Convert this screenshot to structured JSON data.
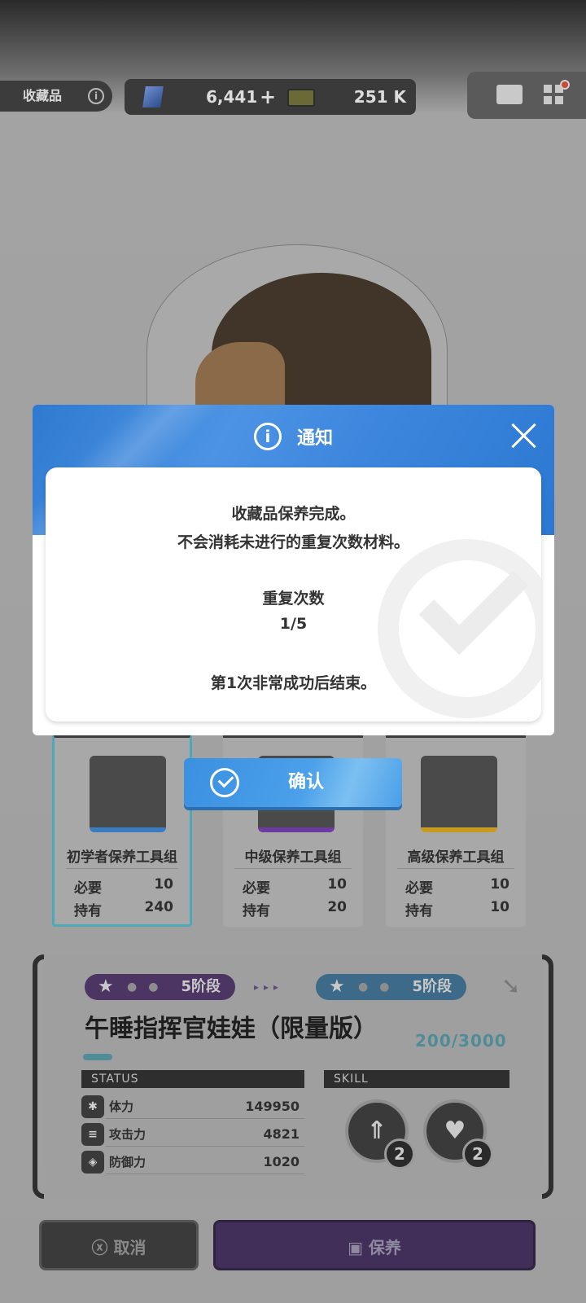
{
  "topbar": {
    "title": "收藏品",
    "info": "i",
    "resource1_value": "6,441",
    "resource1_plus": "+",
    "resource2_value": "251 K"
  },
  "cards": [
    {
      "name": "初学者保养工具组",
      "required_label": "必要",
      "required": "10",
      "owned_label": "持有",
      "owned": "240"
    },
    {
      "name": "中级保养工具组",
      "required_label": "必要",
      "required": "10",
      "owned_label": "持有",
      "owned": "20"
    },
    {
      "name": "高级保养工具组",
      "required_label": "必要",
      "required": "10",
      "owned_label": "持有",
      "owned": "10"
    }
  ],
  "panel": {
    "stage_current": "5阶段",
    "stage_next": "5阶段",
    "collectible_name": "午睡指挥官娃娃（限量版）",
    "xp": "200/3000",
    "status_header": "STATUS",
    "skill_header": "SKILL",
    "stats": [
      {
        "icon": "✱",
        "name": "体力",
        "value": "149950"
      },
      {
        "icon": "≡",
        "name": "攻击力",
        "value": "4821"
      },
      {
        "icon": "◈",
        "name": "防御力",
        "value": "1020"
      }
    ],
    "skills": [
      {
        "level": "2"
      },
      {
        "level": "2"
      }
    ]
  },
  "bottom": {
    "cancel_label": "取消",
    "maintain_label": "保养"
  },
  "modal": {
    "title": "通知",
    "line1": "收藏品保养完成。",
    "line2": "不会消耗未进行的重复次数材料。",
    "repeat_label": "重复次数",
    "repeat_value": "1/5",
    "result": "第1次非常成功后结束。",
    "confirm_label": "确认",
    "accent": "#3d86dd"
  }
}
